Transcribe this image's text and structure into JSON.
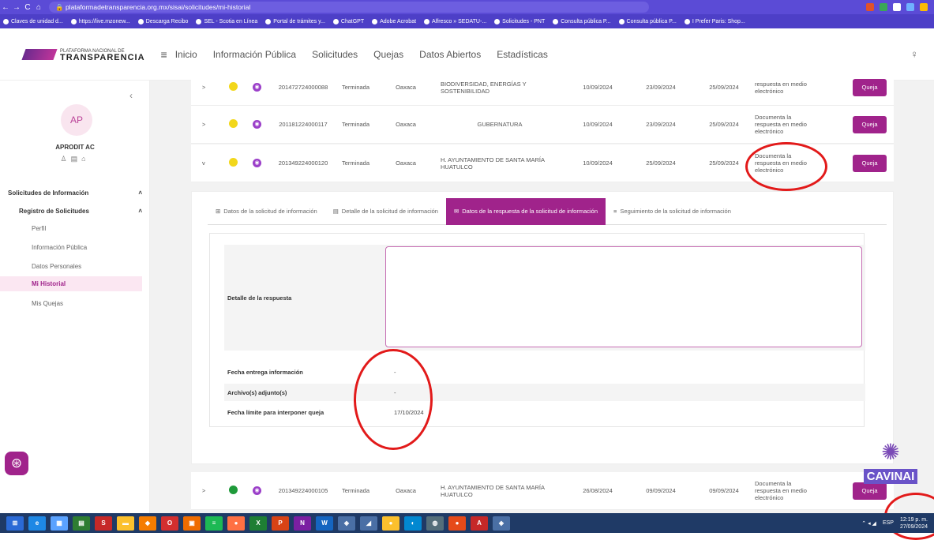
{
  "browser": {
    "url": "plataformadetransparencia.org.mx/sisai/solicitudes/mi-historial",
    "bookmarks": [
      "Claves de unidad d...",
      "https://live.mzonew...",
      "Descarga Recibo",
      "SEL - Scotia en Línea",
      "Portal de trámites y...",
      "ChatGPT",
      "Adobe Acrobat",
      "Alfresco » SEDATU-...",
      "Solicitudes - PNT",
      "Consulta pública P...",
      "Consulta pública P...",
      "I Prefer Paris: Shop..."
    ]
  },
  "header": {
    "logo_small": "PLATAFORMA NACIONAL DE",
    "logo_big": "TRANSPARENCIA",
    "nav": [
      "Inicio",
      "Información Pública",
      "Solicitudes",
      "Quejas",
      "Datos Abiertos",
      "Estadísticas"
    ]
  },
  "sidebar": {
    "avatar": "AP",
    "user_name": "APRODIT AC",
    "section1": "Solicitudes de Información",
    "section2": "Registro de Solicitudes",
    "items": [
      "Perfil",
      "Información Pública",
      "Datos Personales",
      "Mi Historial",
      "Mis Quejas"
    ]
  },
  "rows": [
    {
      "folio": "201472724000088",
      "status": "Terminada",
      "state": "Oaxaca",
      "entity": "BIODIVERSIDAD, ENERGÍAS Y SOSTENIBILIDAD",
      "d1": "10/09/2024",
      "d2": "23/09/2024",
      "d3": "25/09/2024",
      "resp": "respuesta en medio electrónico",
      "btn": "Queja",
      "dot": "#f2d71b",
      "chev": ">"
    },
    {
      "folio": "201181224000117",
      "status": "Terminada",
      "state": "Oaxaca",
      "entity": "GUBERNATURA",
      "d1": "10/09/2024",
      "d2": "23/09/2024",
      "d3": "25/09/2024",
      "resp": "Documenta la respuesta en medio electrónico",
      "btn": "Queja",
      "dot": "#f2d71b",
      "chev": ">"
    },
    {
      "folio": "201349224000120",
      "status": "Terminada",
      "state": "Oaxaca",
      "entity": "H. AYUNTAMIENTO DE SANTA MARÍA HUATULCO",
      "d1": "10/09/2024",
      "d2": "25/09/2024",
      "d3": "25/09/2024",
      "resp": "Documenta la respuesta en medio electrónico",
      "btn": "Queja",
      "dot": "#f2d71b",
      "chev": "v"
    },
    {
      "folio": "201349224000105",
      "status": "Terminada",
      "state": "Oaxaca",
      "entity": "H. AYUNTAMIENTO DE SANTA MARÍA HUATULCO",
      "d1": "26/08/2024",
      "d2": "09/09/2024",
      "d3": "09/09/2024",
      "resp": "Documenta la respuesta en medio electrónico",
      "btn": "Queja",
      "dot": "#1f9a3a",
      "chev": ">"
    }
  ],
  "tabs": [
    "Datos de la solicitud de información",
    "Detalle de la solicitud de información",
    "Datos de la respuesta de la solicitud de información",
    "Seguimiento de la solicitud de información"
  ],
  "detail": {
    "resp_label": "Detalle de la respuesta",
    "fecha_label": "Fecha entrega información",
    "fecha_value": "-",
    "archivo_label": "Archivo(s) adjunto(s)",
    "archivo_value": "-",
    "limite_label": "Fecha límite para interponer queja",
    "limite_value": "17/10/2024"
  },
  "cavinai": {
    "label": "CAVINAI"
  },
  "taskbar": {
    "lang": "ESP",
    "time": "12:19 p. m.",
    "date": "27/09/2024"
  },
  "colors": {
    "accent": "#a0238b",
    "chrome": "#5b4bd6",
    "annotation": "#e21a1a"
  }
}
